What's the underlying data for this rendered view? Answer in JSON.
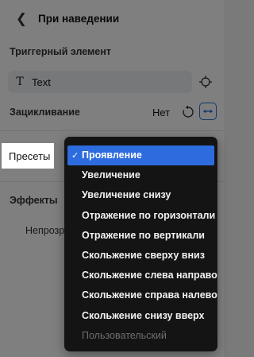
{
  "header": {
    "back_icon": "chevron-left-icon",
    "title": "При наведении"
  },
  "trigger": {
    "section_label": "Триггерный элемент",
    "element_icon": "text-t-icon",
    "element_value": "Text",
    "target_icon": "crosshair-icon"
  },
  "loop": {
    "label": "Зацикливание",
    "value": "Нет",
    "replay_icon": "replay-icon",
    "pingpong_icon": "double-arrow-icon"
  },
  "presets": {
    "label": "Пресеты"
  },
  "effects": {
    "label": "Эффекты",
    "opacity_label": "Непрозрачность"
  },
  "dropdown": {
    "items": [
      {
        "label": "Проявление",
        "state": "selected"
      },
      {
        "label": "Увеличение",
        "state": "normal"
      },
      {
        "label": "Увеличение снизу",
        "state": "normal"
      },
      {
        "label": "Отражение по горизонтали",
        "state": "normal"
      },
      {
        "label": "Отражение по вертикали",
        "state": "normal"
      },
      {
        "label": "Скольжение сверху вниз",
        "state": "normal"
      },
      {
        "label": "Скольжение слева направо",
        "state": "normal"
      },
      {
        "label": "Скольжение справа налево",
        "state": "normal"
      },
      {
        "label": "Скольжение снизу вверх",
        "state": "normal"
      },
      {
        "label": "Пользовательский",
        "state": "disabled"
      }
    ]
  },
  "colors": {
    "accent": "#2d6cdf",
    "dropdown_bg": "#141414",
    "field_bg": "#eef0f3"
  }
}
